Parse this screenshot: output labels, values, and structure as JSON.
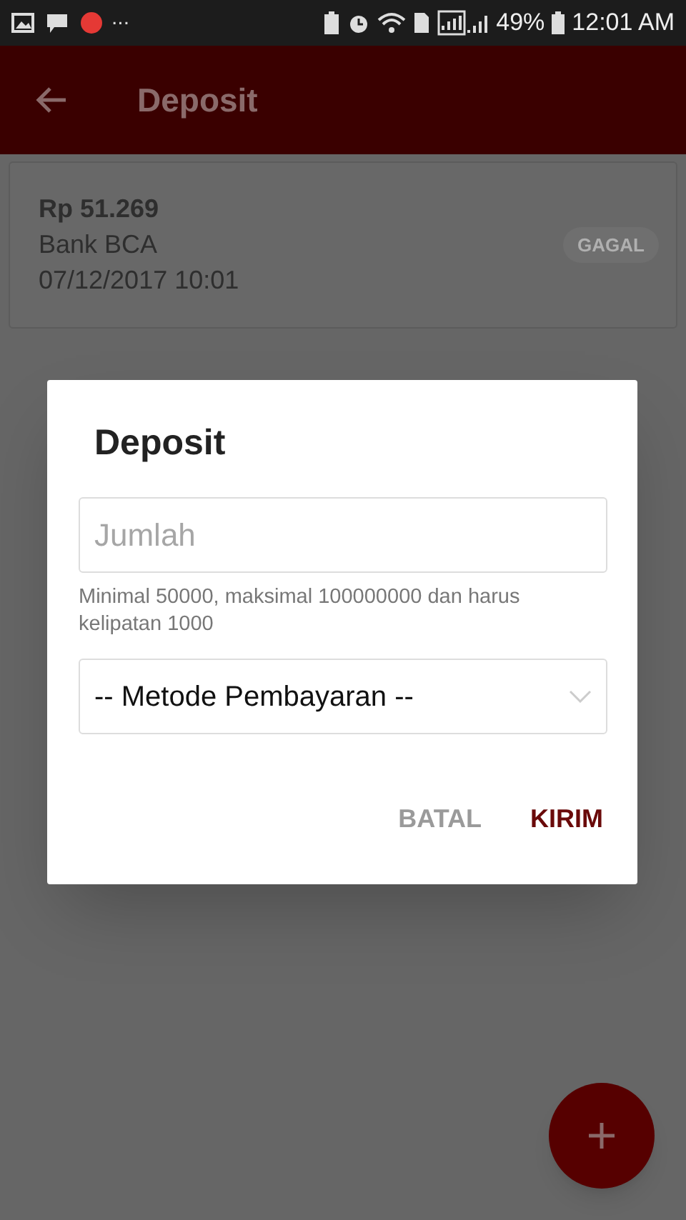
{
  "status_bar": {
    "more": "...",
    "battery": "49%",
    "time": "12:01 AM"
  },
  "app_bar": {
    "title": "Deposit"
  },
  "deposits": [
    {
      "amount": "Rp 51.269",
      "bank": "Bank BCA",
      "date": "07/12/2017 10:01",
      "status": "GAGAL"
    }
  ],
  "dialog": {
    "title": "Deposit",
    "amount_field": {
      "placeholder": "Jumlah"
    },
    "hint": "Minimal 50000, maksimal 100000000 dan harus kelipatan 1000",
    "payment_select": {
      "value": "-- Metode Pembayaran --"
    },
    "buttons": [
      {
        "label": "BATAL",
        "kind": "cancel"
      },
      {
        "label": "KIRIM",
        "kind": "confirm"
      }
    ]
  }
}
